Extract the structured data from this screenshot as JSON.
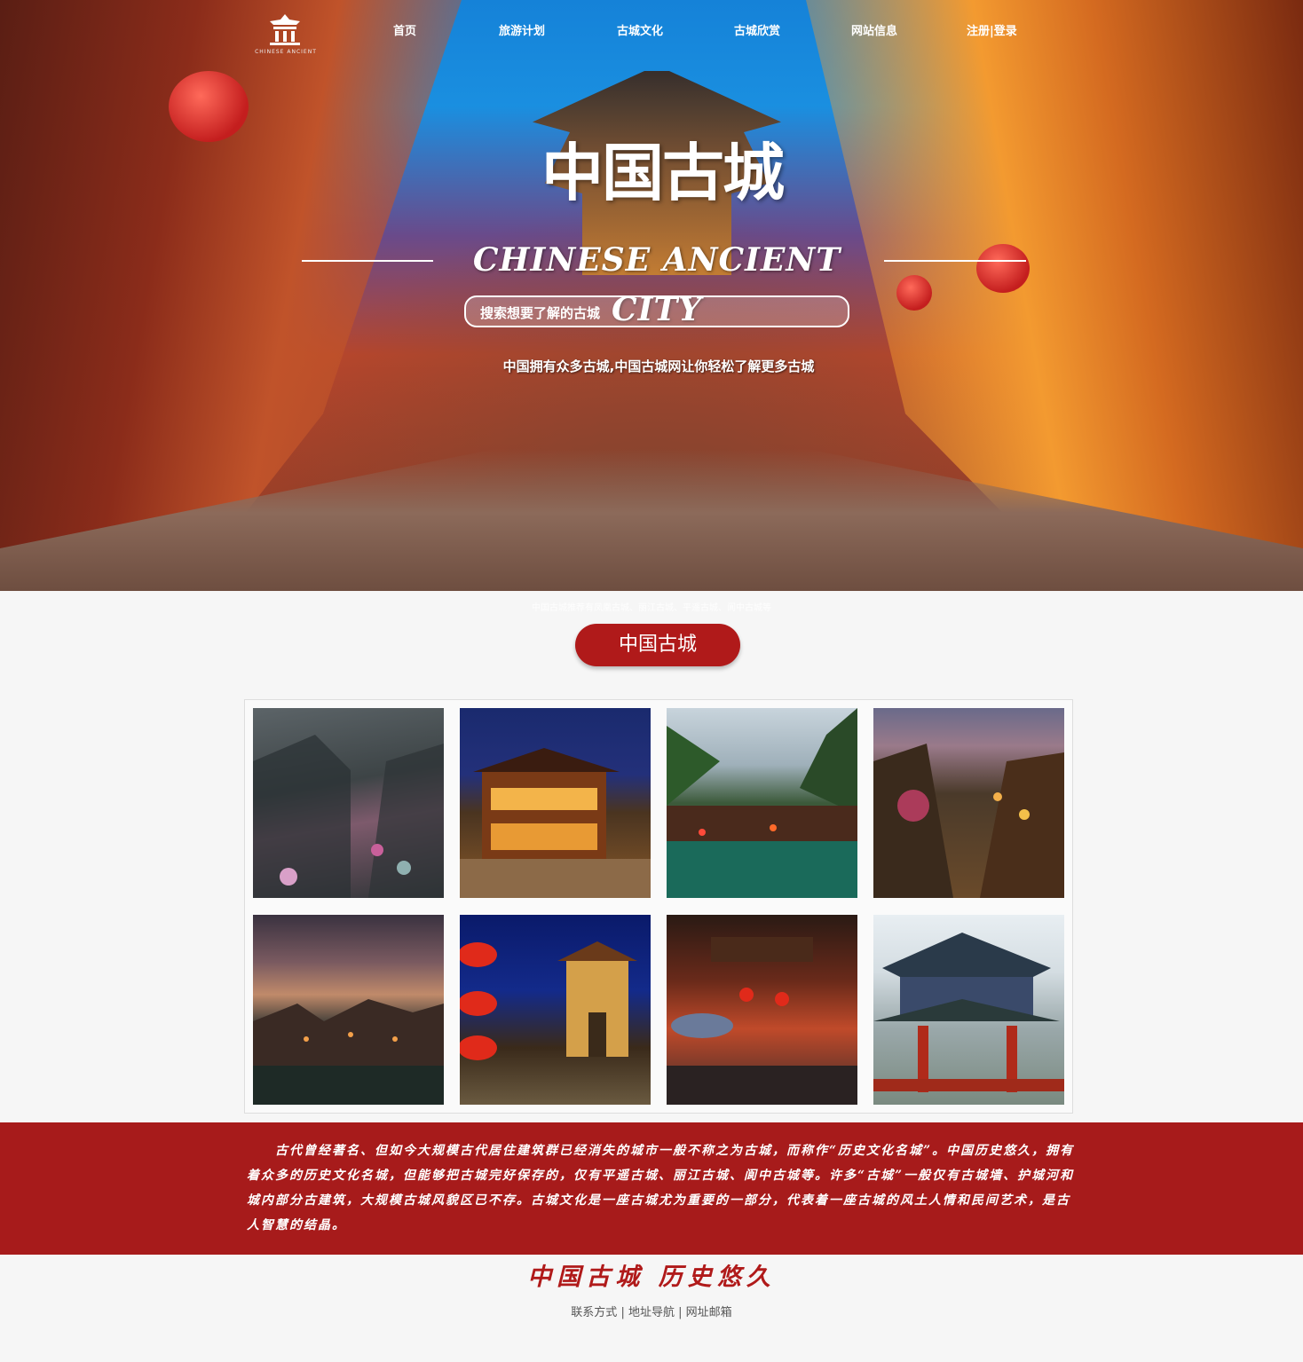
{
  "nav": {
    "logo_icon": "pagoda-icon",
    "logo_subtext": "CHINESE ANCIENT",
    "items": [
      "首页",
      "旅游计划",
      "古城文化",
      "古城欣赏",
      "网站信息",
      "注册|登录"
    ]
  },
  "hero": {
    "title": "中国古城",
    "subtitle": "CHINESE ANCIENT CITY",
    "search_placeholder": "搜索想要了解的古城",
    "tagline": "中国拥有众多古城,中国古城网让你轻松了解更多古城"
  },
  "caption": "中国古城推荐有凤凰古城、丽江古城、平遥古城、阆中古城等",
  "section_title": "中国古城",
  "gallery": {
    "tiles": [
      {
        "alt": "rainy-ancient-street"
      },
      {
        "alt": "night-lit-wooden-building"
      },
      {
        "alt": "riverside-stilt-houses"
      },
      {
        "alt": "evening-town-street"
      },
      {
        "alt": "sunset-town-by-water"
      },
      {
        "alt": "lantern-gate-tower"
      },
      {
        "alt": "night-west-street"
      },
      {
        "alt": "red-pillared-pavilion"
      }
    ]
  },
  "banner_text": "古代曾经著名、但如今大规模古代居住建筑群已经消失的城市一般不称之为古城，而称作“历史文化名城”。中国历史悠久，拥有着众多的历史文化名城，但能够把古城完好保存的，仅有平遥古城、丽江古城、阆中古城等。许多“古城”一般仅有古城墙、护城河和城内部分古建筑，大规模古城风貌区已不存。古城文化是一座古城尤为重要的一部分，代表着一座古城的风土人情和民间艺术，是古人智慧的结晶。",
  "footer": {
    "title": "中国古城 历史悠久",
    "links": [
      "联系方式",
      "地址导航",
      "网址邮箱"
    ],
    "separator": "|"
  },
  "colors": {
    "accent": "#b01a1a",
    "banner": "#a71b1b",
    "page_bg": "#f6f6f6"
  }
}
